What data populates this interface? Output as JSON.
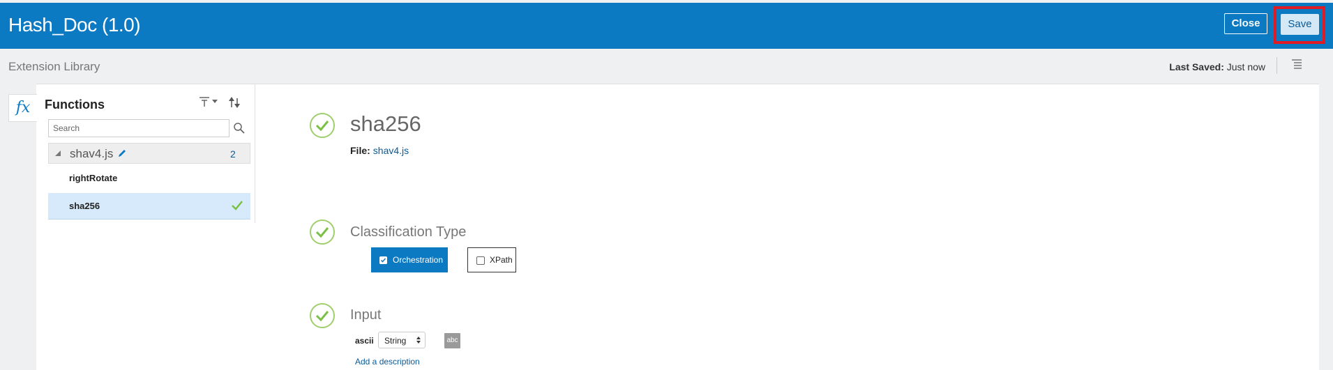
{
  "header": {
    "title": "Hash_Doc (1.0)",
    "close_label": "Close",
    "save_label": "Save"
  },
  "subheader": {
    "title": "Extension Library",
    "last_saved_label": "Last Saved:",
    "last_saved_value": "Just now"
  },
  "sidebar": {
    "fx_label": "fx"
  },
  "functions_panel": {
    "title": "Functions",
    "search_placeholder": "Search",
    "group": {
      "label": "shav4.js",
      "count": "2"
    },
    "items": [
      {
        "label": "rightRotate",
        "selected": false
      },
      {
        "label": "sha256",
        "selected": true
      }
    ]
  },
  "detail": {
    "function_name": "sha256",
    "file_label": "File:",
    "file_name": "shav4.js",
    "classification_heading": "Classification Type",
    "classification_options": [
      {
        "label": "Orchestration",
        "checked": true
      },
      {
        "label": "XPath",
        "checked": false
      }
    ],
    "input_heading": "Input",
    "input_param": {
      "name": "ascii",
      "type": "String",
      "type_badge": "abc",
      "add_description": "Add a description"
    }
  },
  "colors": {
    "brand": "#0b7ac3",
    "check_green": "#7ac143",
    "highlight_red": "#e01b24"
  }
}
